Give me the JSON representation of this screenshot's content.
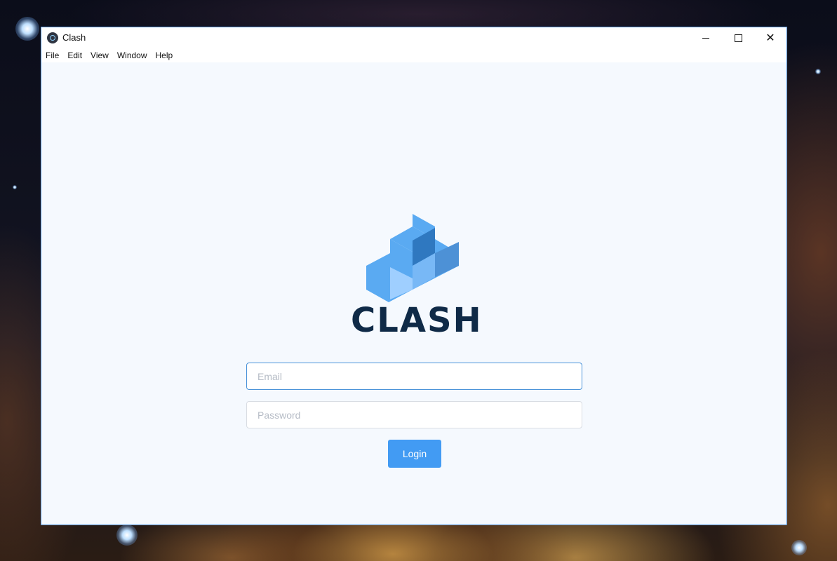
{
  "window": {
    "title": "Clash",
    "controls": {
      "minimize_icon": "minimize-icon",
      "maximize_icon": "maximize-icon",
      "close_icon": "close-icon",
      "close_glyph": "✕"
    }
  },
  "menu": {
    "items": [
      "File",
      "Edit",
      "View",
      "Window",
      "Help"
    ]
  },
  "login": {
    "logo_text": "CLASH",
    "email_placeholder": "Email",
    "email_value": "",
    "password_placeholder": "Password",
    "password_value": "",
    "button_label": "Login"
  },
  "colors": {
    "accent": "#429bf3",
    "logo_dark": "#0f2a47",
    "logo_blue": "#5aaaf2",
    "window_border": "#4d8fd6",
    "content_bg": "#f5f9fe"
  }
}
